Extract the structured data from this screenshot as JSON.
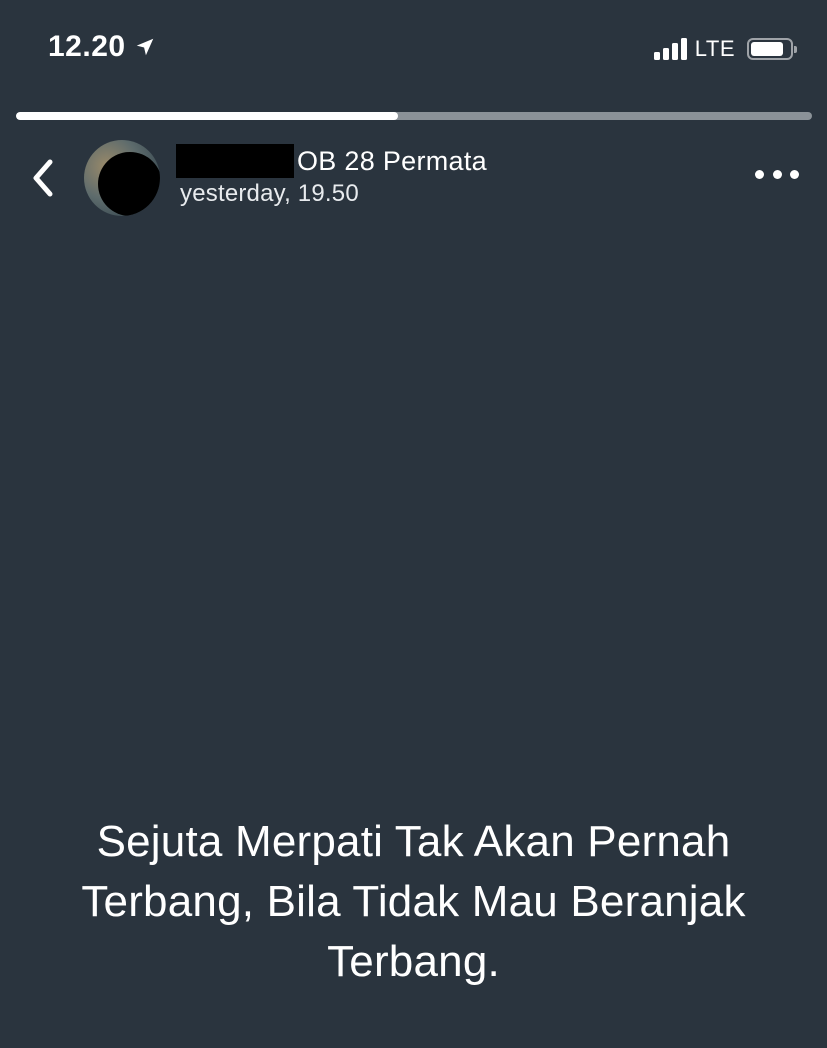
{
  "status_bar": {
    "time": "12.20",
    "network": "LTE",
    "battery_level": 0.85,
    "signal_bars": 4,
    "icons": [
      "location-arrow-icon",
      "signal-icon",
      "battery-icon"
    ]
  },
  "story": {
    "progress": 0.48,
    "contact_name_suffix": "OB 28 Permata",
    "timestamp": "yesterday, 19.50",
    "text": "Sejuta Merpati Tak Akan Pernah Terbang, Bila Tidak Mau Beranjak Terbang.",
    "icons": [
      "chevron-left-icon",
      "more-horizontal-icon"
    ]
  },
  "colors": {
    "background": "#2a343e",
    "text": "#ffffff",
    "progress_track": "#8b9298"
  }
}
